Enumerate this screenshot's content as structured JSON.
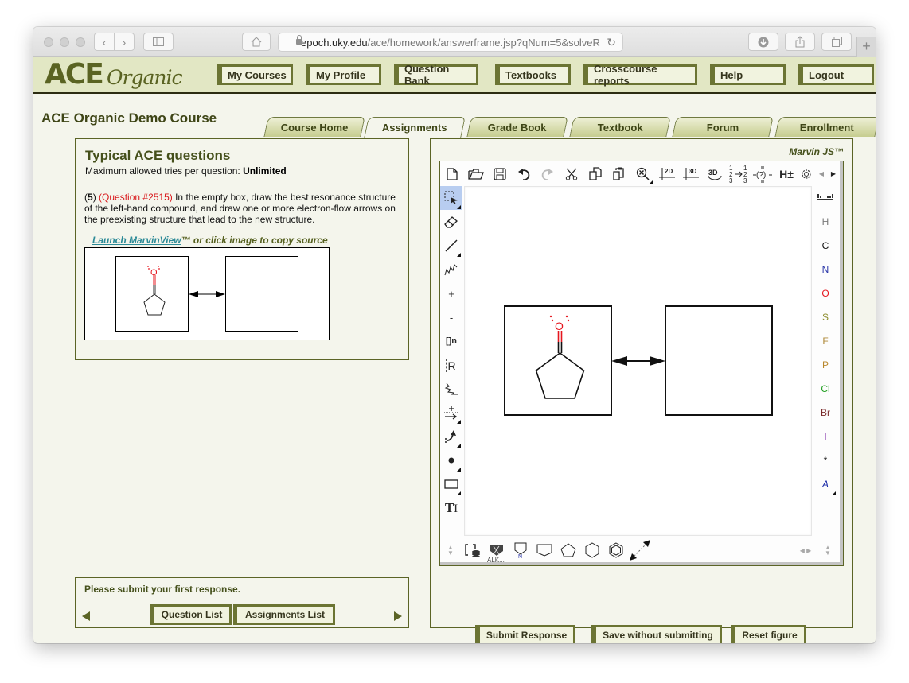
{
  "browser": {
    "url_host": "epoch.uky.edu",
    "url_path": "/ace/homework/answerframe.jsp?qNum=5&solveR",
    "buttons": [
      "back",
      "forward",
      "sidebar",
      "home",
      "reload",
      "downloads",
      "share",
      "tabs",
      "new-tab"
    ]
  },
  "header": {
    "logo_main": "ACE",
    "logo_sub": "Organic",
    "nav": [
      {
        "label": "My Courses"
      },
      {
        "label": "My Profile"
      },
      {
        "label": "Question Bank"
      },
      {
        "label": "Textbooks"
      },
      {
        "label": "Crosscourse reports"
      },
      {
        "label": "Help"
      },
      {
        "label": "Logout"
      }
    ]
  },
  "course": {
    "title": "ACE Organic Demo Course",
    "tabs": [
      {
        "label": "Course Home",
        "active": false
      },
      {
        "label": "Assignments",
        "active": true
      },
      {
        "label": "Grade Book",
        "active": false
      },
      {
        "label": "Textbook",
        "active": false
      },
      {
        "label": "Forum",
        "active": false
      },
      {
        "label": "Enrollment",
        "active": false
      }
    ]
  },
  "question": {
    "assignment_title": "Typical ACE questions",
    "tries_label": "Maximum allowed tries per question: ",
    "tries_value": "Unlimited",
    "number_open": "(",
    "number": "5",
    "number_close": ")",
    "question_id": "(Question #2515)",
    "text": " In the empty box, draw the best resonance structure of the left-hand compound, and draw one or more electron-flow arrows on the preexisting structure that lead to the new structure.",
    "launch_link": "Launch MarvinView",
    "launch_suffix": "™ or click image to copy source",
    "thumbnail_atom_label": "O"
  },
  "submission": {
    "message": "Please submit your first response.",
    "question_list": "Question List",
    "assignments_list": "Assignments List",
    "prev": "previous-question",
    "next": "next-question"
  },
  "editor": {
    "label": "Marvin JS™",
    "top_toolbar": [
      "new-document",
      "open",
      "save",
      "undo",
      "redo",
      "cut",
      "copy",
      "paste",
      "zoom-clear",
      "clean-2d",
      "clean-3d",
      "rotate-3d",
      "renumber",
      "unknown-bond",
      "add-remove-hydrogens",
      "settings"
    ],
    "top_labels": {
      "clean2d": "2D",
      "clean3d": "3D",
      "rot3d": "3D",
      "hplus": "H±"
    },
    "left_toolbar": [
      "select",
      "erase",
      "single-bond",
      "chain",
      "increase-charge",
      "decrease-charge",
      "sgroup",
      "rgroup",
      "attachment-point",
      "reaction-arrow",
      "electron-flow-arrow",
      "lone-pair",
      "rectangle",
      "text"
    ],
    "left_labels": {
      "plus": "+",
      "minus": "-",
      "sgroup": "[]n",
      "rgroup": "R"
    },
    "elements": [
      {
        "symbol": "H",
        "color": "#7a7a7a"
      },
      {
        "symbol": "C",
        "color": "#111111"
      },
      {
        "symbol": "N",
        "color": "#2a36a8"
      },
      {
        "symbol": "O",
        "color": "#e5161e"
      },
      {
        "symbol": "S",
        "color": "#8b8b2a"
      },
      {
        "symbol": "F",
        "color": "#b08a3a"
      },
      {
        "symbol": "P",
        "color": "#b8862a"
      },
      {
        "symbol": "Cl",
        "color": "#22a022"
      },
      {
        "symbol": "Br",
        "color": "#7a2a2a"
      },
      {
        "symbol": "I",
        "color": "#8a3fb0"
      },
      {
        "symbol": "*",
        "color": "#111111"
      },
      {
        "symbol": "A",
        "color": "#1a2aa8"
      }
    ],
    "bottom_toolbar": [
      "template-library",
      "alkanes",
      "pyrrole",
      "cyclobutane",
      "cyclopentane",
      "cyclohexane",
      "benzene",
      "resize-arrow"
    ],
    "alk_caption": "ALK...",
    "canvas_atom_label": "O",
    "actions": {
      "submit": "Submit Response",
      "save": "Save without submitting",
      "reset": "Reset figure"
    }
  }
}
